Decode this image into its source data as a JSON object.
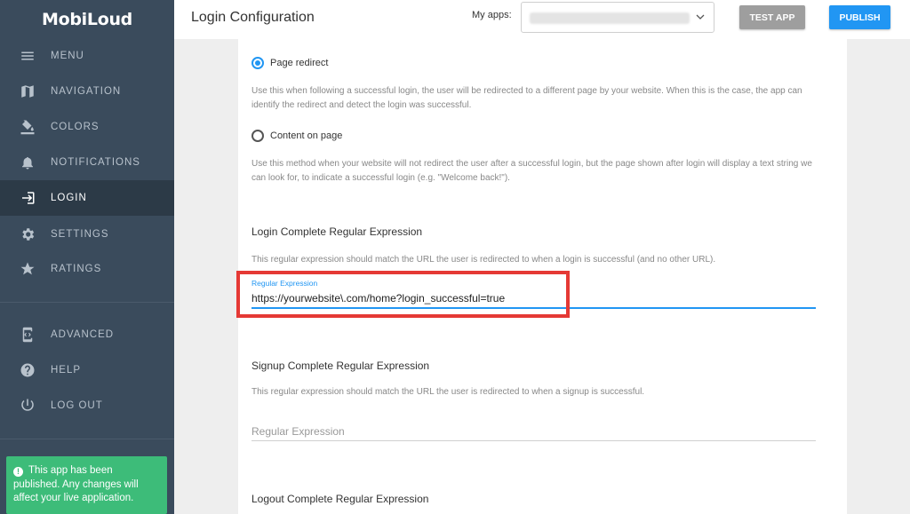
{
  "brand": "MobiLoud",
  "sidebar": {
    "items": [
      {
        "label": "MENU",
        "icon": "menu-icon"
      },
      {
        "label": "NAVIGATION",
        "icon": "map-icon"
      },
      {
        "label": "COLORS",
        "icon": "paint-bucket-icon"
      },
      {
        "label": "NOTIFICATIONS",
        "icon": "bell-icon"
      },
      {
        "label": "LOGIN",
        "icon": "login-icon",
        "active": true
      },
      {
        "label": "SETTINGS",
        "icon": "gear-icon"
      },
      {
        "label": "RATINGS",
        "icon": "star-icon"
      },
      {
        "label": "ADVANCED",
        "icon": "developer-mode-icon"
      },
      {
        "label": "HELP",
        "icon": "help-icon"
      },
      {
        "label": "LOG OUT",
        "icon": "power-icon"
      }
    ],
    "notice": "This app has been published. Any changes will affect your live application."
  },
  "header": {
    "title": "Login Configuration",
    "apps_label": "My apps:",
    "test_app": "TEST APP",
    "publish": "PUBLISH"
  },
  "content": {
    "page_redirect_label": "Page redirect",
    "page_redirect_help": "Use this when following a successful login, the user will be redirected to a different page by your website. When this is the case, the app can identify the redirect and detect the login was successful.",
    "content_on_page_label": "Content on page",
    "content_on_page_help": "Use this method when your website will not redirect the user after a successful login, but the page shown after login will display a text string we can look for, to indicate a successful login (e.g. \"Welcome back!\").",
    "login_regex_title": "Login Complete Regular Expression",
    "login_regex_help": "This regular expression should match the URL the user is redirected to when a login is successful (and no other URL).",
    "login_regex_label": "Regular Expression",
    "login_regex_value": "https://yourwebsite\\.com/home?login_successful=true",
    "signup_regex_title": "Signup Complete Regular Expression",
    "signup_regex_help": "This regular expression should match the URL the user is redirected to when a signup is successful.",
    "signup_regex_placeholder": "Regular Expression",
    "logout_regex_title": "Logout Complete Regular Expression"
  },
  "colors": {
    "sidebar_bg": "#3a4b5c",
    "accent": "#2196f3",
    "published_notice": "#3dbc79",
    "highlight_box": "#e53935"
  }
}
